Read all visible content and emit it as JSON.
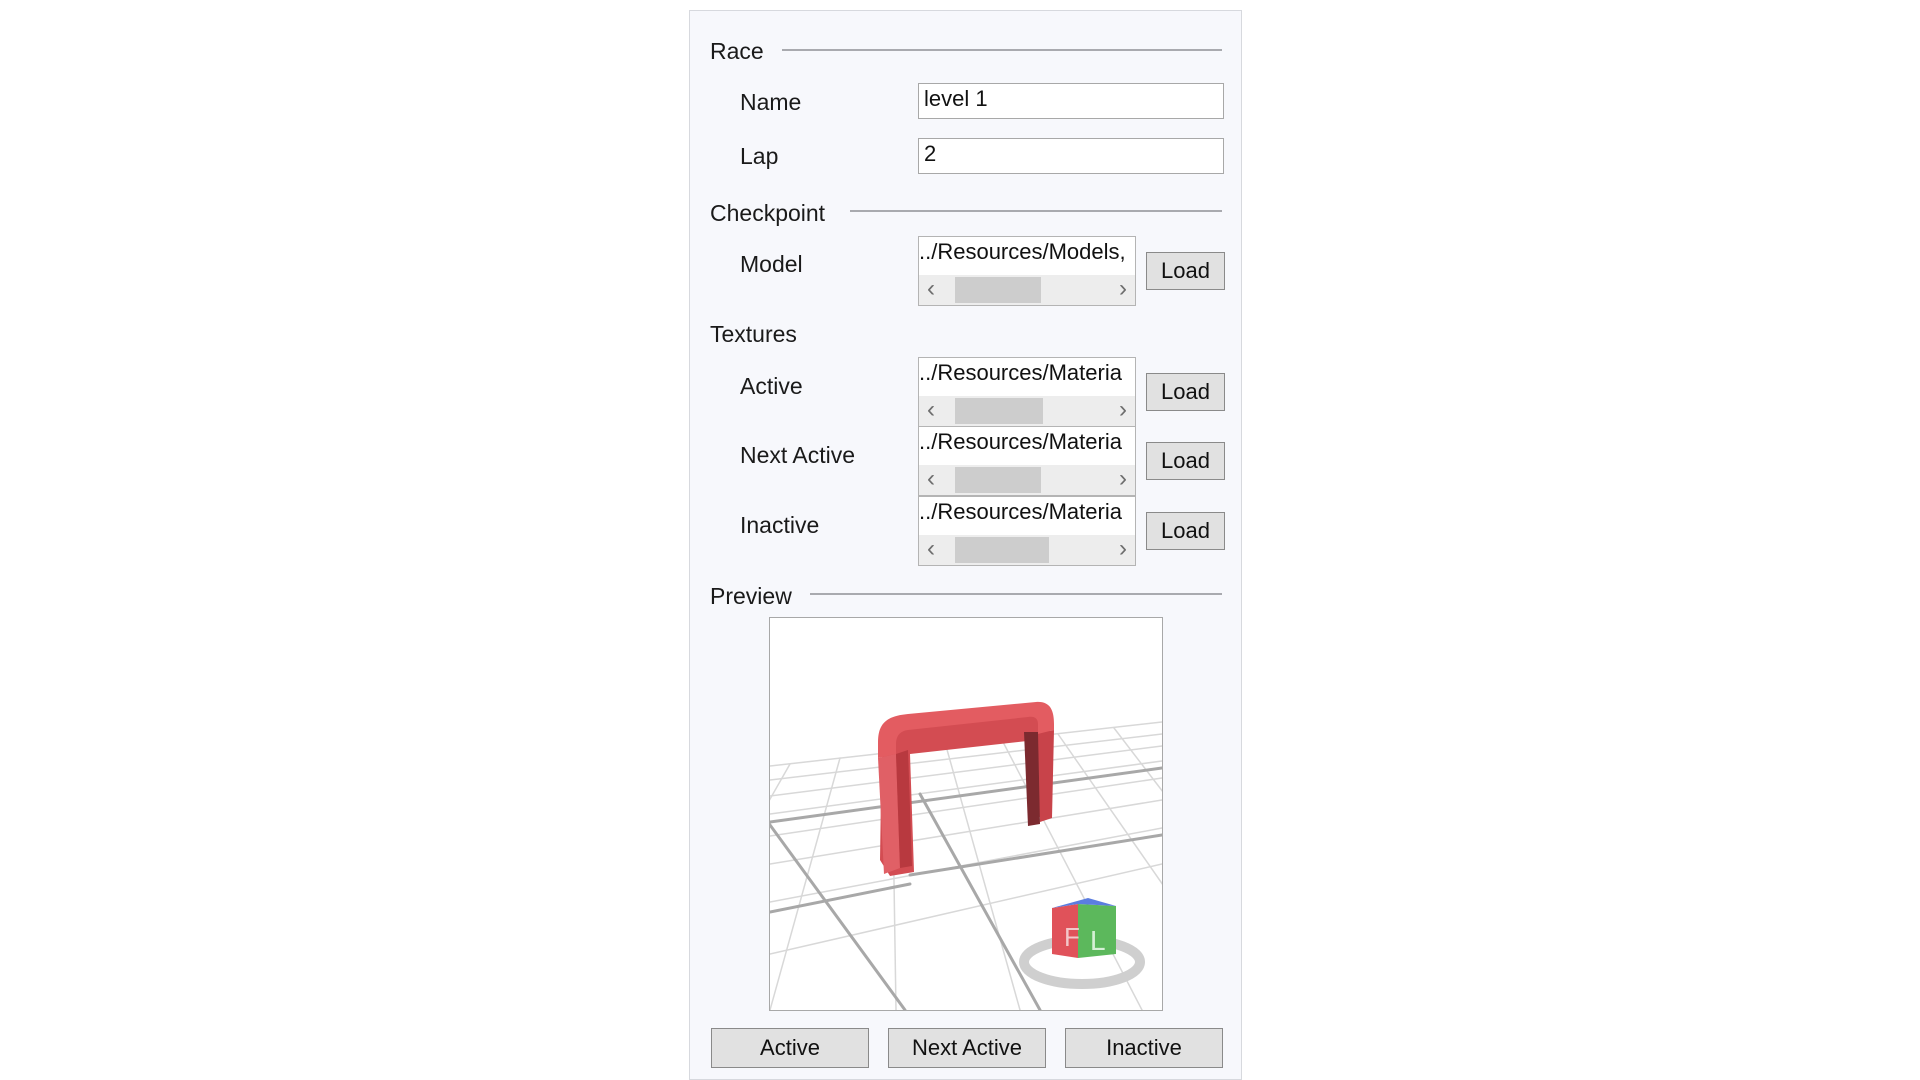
{
  "race": {
    "section_label": "Race",
    "name_label": "Name",
    "name_value": "level 1",
    "lap_label": "Lap",
    "lap_value": "2"
  },
  "checkpoint": {
    "section_label": "Checkpoint",
    "model_label": "Model",
    "model_path": "../Resources/Models,",
    "load_label": "Load"
  },
  "textures": {
    "section_label": "Textures",
    "items": [
      {
        "label": "Active",
        "path": "../Resources/Materia",
        "load_label": "Load"
      },
      {
        "label": "Next Active",
        "path": "../Resources/Materia",
        "load_label": "Load"
      },
      {
        "label": "Inactive",
        "path": "../Resources/Materia",
        "load_label": "Load"
      }
    ]
  },
  "preview": {
    "section_label": "Preview",
    "buttons": [
      "Active",
      "Next Active",
      "Inactive"
    ],
    "gate_color": "#e0575c",
    "view_cube": {
      "front_letter": "F",
      "left_letter": "L"
    }
  },
  "colors": {
    "panel_bg": "#f7f8fc",
    "button_bg": "#e1e1e1"
  }
}
